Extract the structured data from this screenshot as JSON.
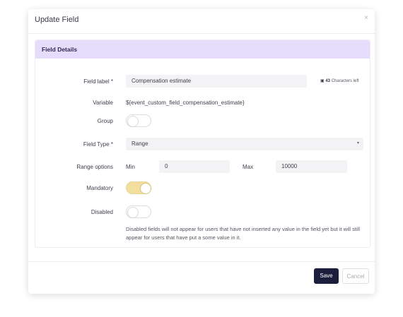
{
  "modal": {
    "title": "Update Field",
    "close_glyph": "×",
    "section_title": "Field Details"
  },
  "field_label": {
    "label": "Field label *",
    "value": "Compensation estimate",
    "counter_value": "43",
    "counter_text": "Characters left"
  },
  "variable": {
    "label": "Variable",
    "value": "${event_custom_field_compensation_estimate}"
  },
  "group": {
    "label": "Group",
    "enabled": false
  },
  "field_type": {
    "label": "Field Type *",
    "value": "Range",
    "caret_glyph": "▾"
  },
  "range_options": {
    "label": "Range options",
    "min_label": "Min",
    "min_value": "0",
    "max_label": "Max",
    "max_value": "10000"
  },
  "mandatory": {
    "label": "Mandatory",
    "enabled": true
  },
  "disabled": {
    "label": "Disabled",
    "enabled": false,
    "hint": "Disabled fields will not appear for users that have not inserted any value in the field yet but it will still appear for users that have put a some value in it."
  },
  "footer": {
    "save_label": "Save",
    "cancel_label": "Cancel"
  },
  "colors": {
    "section_header_bg": "#e6dcfb",
    "toggle_on": "#f2dfa0",
    "primary_button": "#1b1f3b"
  }
}
